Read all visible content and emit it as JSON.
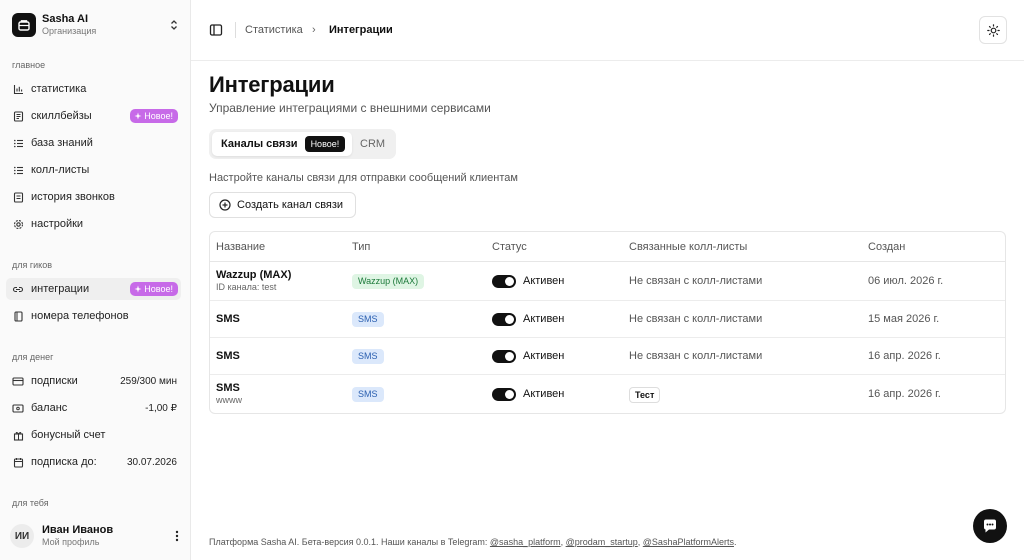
{
  "org": {
    "name": "Sasha AI",
    "subtitle": "Организация"
  },
  "sidebar": {
    "sections": [
      {
        "label": "главное"
      },
      {
        "label": "для гиков"
      },
      {
        "label": "для денег"
      },
      {
        "label": "для тебя"
      }
    ],
    "main_items": [
      {
        "label": "статистика",
        "icon": "bar-chart-icon"
      },
      {
        "label": "скиллбейзы",
        "icon": "document-list-icon",
        "badge": "Новое!"
      },
      {
        "label": "база знаний",
        "icon": "list-icon"
      },
      {
        "label": "колл-листы",
        "icon": "list-icon"
      },
      {
        "label": "история звонков",
        "icon": "history-icon"
      },
      {
        "label": "настройки",
        "icon": "gear-icon"
      }
    ],
    "geek_items": [
      {
        "label": "интеграции",
        "icon": "link-icon",
        "badge": "Новое!",
        "active": true
      },
      {
        "label": "номера телефонов",
        "icon": "book-icon"
      }
    ],
    "money_items": [
      {
        "label": "подписки",
        "icon": "card-icon",
        "value": "259/300 мин"
      },
      {
        "label": "баланс",
        "icon": "wallet-icon",
        "value": "-1,00 ₽"
      },
      {
        "label": "бонусный счет",
        "icon": "gift-icon"
      },
      {
        "label": "подписка до:",
        "icon": "calendar-icon",
        "value": "30.07.2026"
      }
    ],
    "profile": {
      "initials": "ИИ",
      "name": "Иван Иванов",
      "subtitle": "Мой профиль"
    }
  },
  "header": {
    "breadcrumb": [
      "Статистика",
      "Интеграции"
    ],
    "separator": "›"
  },
  "main": {
    "title": "Интеграции",
    "subtitle": "Управление интеграциями с внешними сервисами",
    "tabs": [
      {
        "label": "Каналы связи",
        "badge": "Новое!",
        "active": true
      },
      {
        "label": "CRM"
      }
    ],
    "helper": "Настройте каналы связи для отправки сообщений клиентам",
    "create_button": "Создать канал связи"
  },
  "table": {
    "columns": [
      "Название",
      "Тип",
      "Статус",
      "Связанные колл-листы",
      "Создан"
    ],
    "rows": [
      {
        "name": "Wazzup (MAX)",
        "sub": "ID канала: test",
        "type": "Wazzup (MAX)",
        "type_color": "green",
        "status": "Активен",
        "enabled": true,
        "linked": "Не связан с колл-листами",
        "linked_tag": false,
        "created": "06 июл. 2026 г."
      },
      {
        "name": "SMS",
        "sub": "",
        "type": "SMS",
        "type_color": "blue",
        "status": "Активен",
        "enabled": true,
        "linked": "Не связан с колл-листами",
        "linked_tag": false,
        "created": "15 мая 2026 г."
      },
      {
        "name": "SMS",
        "sub": "",
        "type": "SMS",
        "type_color": "blue",
        "status": "Активен",
        "enabled": true,
        "linked": "Не связан с колл-листами",
        "linked_tag": false,
        "created": "16 апр. 2026 г."
      },
      {
        "name": "SMS",
        "sub": "wwww",
        "type": "SMS",
        "type_color": "blue",
        "status": "Активен",
        "enabled": true,
        "linked": "Тест",
        "linked_tag": true,
        "created": "16 апр. 2026 г."
      }
    ]
  },
  "footer": {
    "text": "Платформа Sasha AI. Бета-версия 0.0.1. Наши каналы в Telegram: ",
    "links": [
      "@sasha_platform",
      "@prodam_startup",
      "@SashaPlatformAlerts"
    ],
    "sep": ", ",
    "end": "."
  },
  "colors": {
    "accent_badge": "#c76ae8",
    "green_pill": "#dff5e4",
    "blue_pill": "#dbe8fb"
  }
}
